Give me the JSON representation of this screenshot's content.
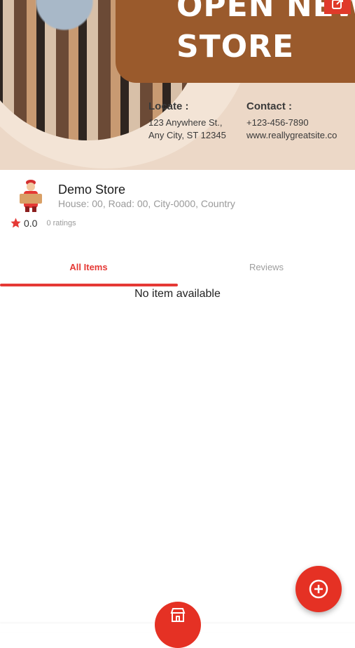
{
  "banner": {
    "headline_line1": "OPEN NEW",
    "headline_line2": "STORE",
    "locate_label": "Locate :",
    "locate_line1": "123 Anywhere St.,",
    "locate_line2": "Any City, ST 12345",
    "contact_label": "Contact :",
    "contact_line1": "+123-456-7890",
    "contact_line2": "www.reallygreatsite.co",
    "share_icon": "share-icon"
  },
  "store": {
    "name": "Demo Store",
    "address": "House: 00, Road: 00, City-0000, Country",
    "rating_value": "0.0",
    "rating_count": "0 ratings",
    "avatar_icon": "delivery-man-icon"
  },
  "tabs": [
    {
      "label": "All Items",
      "active": true
    },
    {
      "label": "Reviews",
      "active": false
    }
  ],
  "content": {
    "empty_message": "No item available"
  },
  "fab": {
    "icon": "add-circle-icon"
  },
  "bottom_nav": {
    "center_icon": "store-icon"
  },
  "colors": {
    "accent": "#e53935",
    "banner_brown": "#9a5a2c",
    "banner_bg": "#ecd8c7"
  }
}
